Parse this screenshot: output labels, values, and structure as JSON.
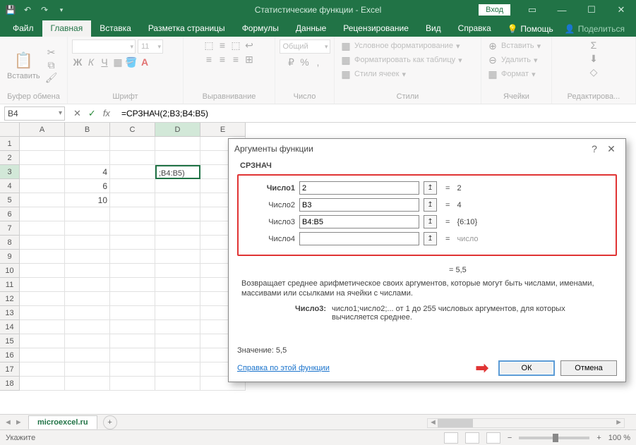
{
  "titlebar": {
    "title": "Статистические функции - Excel",
    "login": "Вход"
  },
  "tabs": {
    "file": "Файл",
    "home": "Главная",
    "insert": "Вставка",
    "layout": "Разметка страницы",
    "formulas": "Формулы",
    "data": "Данные",
    "review": "Рецензирование",
    "view": "Вид",
    "help": "Справка",
    "tell_me": "Помощь",
    "share": "Поделиться"
  },
  "ribbon": {
    "clipboard": {
      "label": "Буфер обмена",
      "paste": "Вставить"
    },
    "font": {
      "label": "Шрифт",
      "size": "11"
    },
    "alignment": {
      "label": "Выравнивание"
    },
    "number": {
      "label": "Число",
      "format": "Общий"
    },
    "styles": {
      "label": "Стили",
      "cond": "Условное форматирование",
      "table": "Форматировать как таблицу",
      "cell": "Стили ячеек"
    },
    "cells": {
      "label": "Ячейки",
      "insert": "Вставить",
      "delete": "Удалить",
      "format": "Формат"
    },
    "editing": {
      "label": "Редактирова..."
    }
  },
  "namebox": "B4",
  "formula": "=СРЗНАЧ(2;B3;B4:B5)",
  "grid": {
    "cols": [
      "A",
      "B",
      "C",
      "D",
      "E"
    ],
    "rows": 18,
    "b3": "4",
    "b4": "6",
    "b5": "10",
    "d3": ";B4:B5)"
  },
  "dialog": {
    "title": "Аргументы функции",
    "fn": "СРЗНАЧ",
    "args": [
      {
        "label": "Число1",
        "value": "2",
        "result": "2",
        "bold": true
      },
      {
        "label": "Число2",
        "value": "B3",
        "result": "4",
        "bold": false
      },
      {
        "label": "Число3",
        "value": "B4:B5",
        "result": "{6:10}",
        "bold": false
      },
      {
        "label": "Число4",
        "value": "",
        "result": "число",
        "bold": false,
        "gray": true
      }
    ],
    "overall_result": "= 5,5",
    "description": "Возвращает среднее арифметическое своих аргументов, которые могут быть числами, именами, массивами или ссылками на ячейки с числами.",
    "param_name": "Число3:",
    "param_desc": "число1;число2;... от 1 до 255 числовых аргументов, для которых вычисляется среднее.",
    "value_label": "Значение:",
    "value": "5,5",
    "help": "Справка по этой функции",
    "ok": "ОК",
    "cancel": "Отмена"
  },
  "sheets": {
    "tab1": "microexcel.ru"
  },
  "statusbar": {
    "mode": "Укажите",
    "zoom": "100 %"
  }
}
